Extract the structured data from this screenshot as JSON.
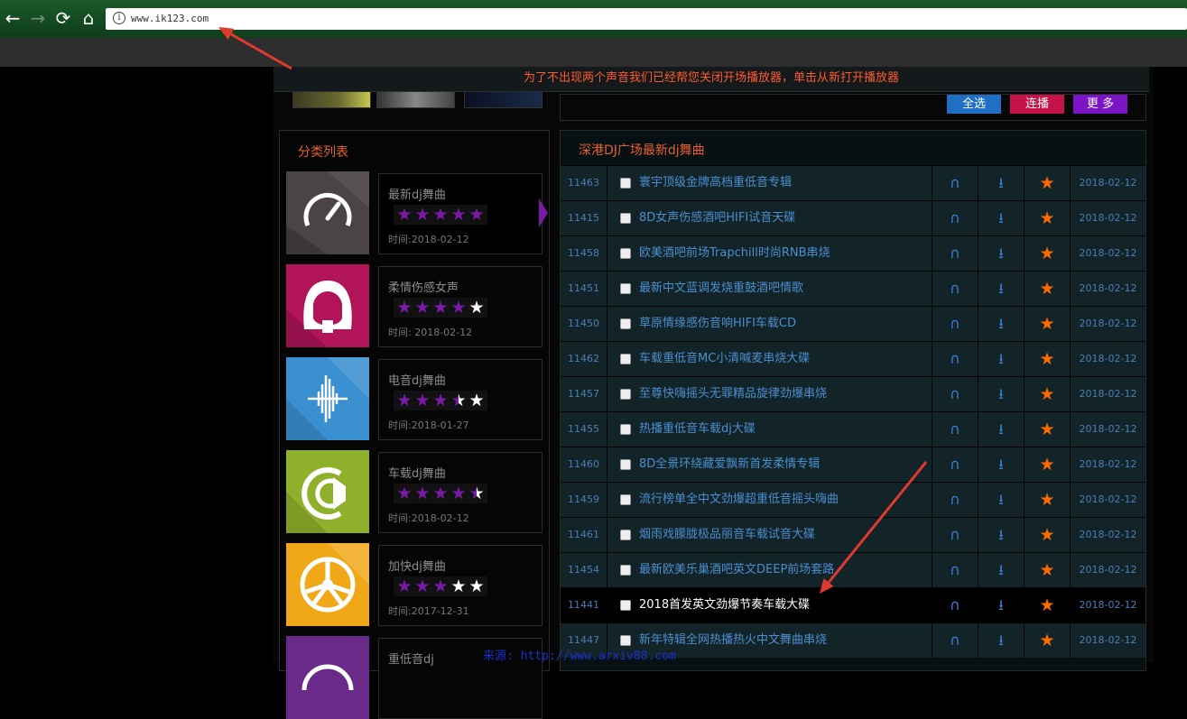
{
  "browser": {
    "url": "www.ik123.com",
    "back_glyph": "←",
    "forward_glyph": "→",
    "reload_glyph": "⟳",
    "home_glyph": "⌂",
    "info_glyph": "i"
  },
  "notice": "为了不出现两个声音我们已经帮您关闭开场播放器，单击从新打开播放器",
  "toolbar": {
    "select_all": "全选",
    "continuous_play": "连播",
    "more": "更 多",
    "colors": {
      "select_all": "#1f6fc4",
      "continuous_play": "#c4124a",
      "more": "#7a14c4"
    }
  },
  "categories": {
    "title": "分类列表",
    "star_filled_color": "#7a1aa8",
    "star_empty_color": "#ffffff",
    "items": [
      {
        "name": "最新dj舞曲",
        "rating": 5,
        "date": "时间:2018-02-12",
        "icon": "speedometer-icon",
        "color": "#4a4446"
      },
      {
        "name": "柔情伤感女声",
        "rating": 4,
        "date": "时间: 2018-02-12",
        "icon": "woman-face-icon",
        "color": "#b2145a"
      },
      {
        "name": "电音dj舞曲",
        "rating": 3.5,
        "date": "时间:2018-01-27",
        "icon": "soundwave-icon",
        "color": "#3a8fd0"
      },
      {
        "name": "车载dj舞曲",
        "rating": 4.5,
        "date": "时间:2018-02-12",
        "icon": "horn-icon",
        "color": "#8fb02a"
      },
      {
        "name": "加快dj舞曲",
        "rating": 3,
        "date": "时间:2017-12-31",
        "icon": "wheel-icon",
        "color": "#f0a818"
      },
      {
        "name": "重低音dj",
        "rating": null,
        "date": "",
        "icon": "bass-icon",
        "color": "#6a2a8a"
      }
    ]
  },
  "songs": {
    "title": "深港DJ广场最新dj舞曲",
    "listen_glyph": "∩",
    "download_glyph": "⭳",
    "favorite_glyph": "★",
    "items": [
      {
        "id": "11463",
        "name": "寰宇顶级金牌高档重低音专辑",
        "date": "2018-02-12"
      },
      {
        "id": "11415",
        "name": "8D女声伤感酒吧HIFI试音天碟",
        "date": "2018-02-12"
      },
      {
        "id": "11458",
        "name": "欧美酒吧前场Trapchill时尚RNB串烧",
        "date": "2018-02-12"
      },
      {
        "id": "11451",
        "name": "最新中文蓝调发烧重鼓酒吧情歌",
        "date": "2018-02-12"
      },
      {
        "id": "11450",
        "name": "草原情缘感伤音响HIFI车载CD",
        "date": "2018-02-12"
      },
      {
        "id": "11462",
        "name": "车载重低音MC小清喊麦串烧大碟",
        "date": "2018-02-12"
      },
      {
        "id": "11457",
        "name": "至尊快嗨摇头无罪精品旋律劲爆串烧",
        "date": "2018-02-12"
      },
      {
        "id": "11455",
        "name": "热播重低音车载dj大碟",
        "date": "2018-02-12"
      },
      {
        "id": "11460",
        "name": "8D全景环绕藏爱飘新首发柔情专辑",
        "date": "2018-02-12"
      },
      {
        "id": "11459",
        "name": "流行榜单全中文劲爆超重低音摇头嗨曲",
        "date": "2018-02-12"
      },
      {
        "id": "11461",
        "name": "烟雨戏朦胧极品丽音车载试音大碟",
        "date": "2018-02-12"
      },
      {
        "id": "11454",
        "name": "最新欧美乐巢酒吧英文DEEP前场套路",
        "date": "2018-02-12"
      },
      {
        "id": "11441",
        "name": "2018首发英文劲爆节奏车载大碟",
        "date": "2018-02-12",
        "highlighted": true
      },
      {
        "id": "11447",
        "name": "新年特辑全网热播热火中文舞曲串烧",
        "date": "2018-02-12"
      }
    ]
  },
  "watermark": "来源: http://www.arxiv88.com",
  "annotation_color": "#e03a30"
}
